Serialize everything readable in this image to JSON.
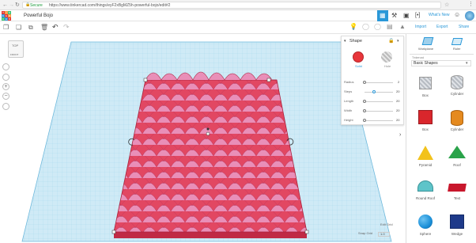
{
  "browser": {
    "secure_label": "Secure",
    "url": "https://www.tinkercad.com/things/eyF2xBgMZ5h-powerful-bojo/edit#2"
  },
  "appbar": {
    "logo_letters": [
      "T",
      "I",
      "N",
      "K",
      "E",
      "R",
      "C",
      "A",
      "D"
    ],
    "design_title": "Powerful Bojo",
    "whats_new": "What's New"
  },
  "toolbar": {
    "import_label": "Import",
    "export_label": "Export",
    "share_label": "Share"
  },
  "view_cube": {
    "top_label": "TOP",
    "front_label": "FRONT"
  },
  "shape_panel": {
    "title": "Shape",
    "solid_label": "Solid",
    "hole_label": "Hole",
    "solid_color": "#e8363b",
    "props": [
      {
        "label": "Radius",
        "value": "2"
      },
      {
        "label": "Steps",
        "value": "20"
      },
      {
        "label": "Length",
        "value": "20"
      },
      {
        "label": "Width",
        "value": "20"
      },
      {
        "label": "Height",
        "value": "20"
      }
    ]
  },
  "canvas_footer": {
    "edit_grid_label": "Edit Grid",
    "snap_grid_label": "Snap Grid",
    "snap_grid_value": "1.0"
  },
  "sidebar": {
    "workplane_label": "Workplane",
    "ruler_label": "Ruler",
    "category_header": "Tinkercad",
    "category_value": "Basic Shapes",
    "shapes": [
      {
        "label": "Box",
        "color": "#b7bcc3"
      },
      {
        "label": "Cylinder",
        "color": "#b7bcc3"
      },
      {
        "label": "Box",
        "color": "#d9262c"
      },
      {
        "label": "Cylinder",
        "color": "#e58a1f"
      },
      {
        "label": "Pyramid",
        "color": "#f2c21c"
      },
      {
        "label": "Roof",
        "color": "#2aa34a"
      },
      {
        "label": "Round Roof",
        "color": "#5ec4c9"
      },
      {
        "label": "Text",
        "color": "#c8172c"
      },
      {
        "label": "Sphere",
        "color": "#1a8fd8"
      },
      {
        "label": "Wedge",
        "color": "#1e3a8a"
      }
    ]
  },
  "colors": {
    "accent": "#2a98d8",
    "grid_blue": "#bfe3f3",
    "shape_red": "#e0405e",
    "shape_pink": "#e98fb8"
  }
}
